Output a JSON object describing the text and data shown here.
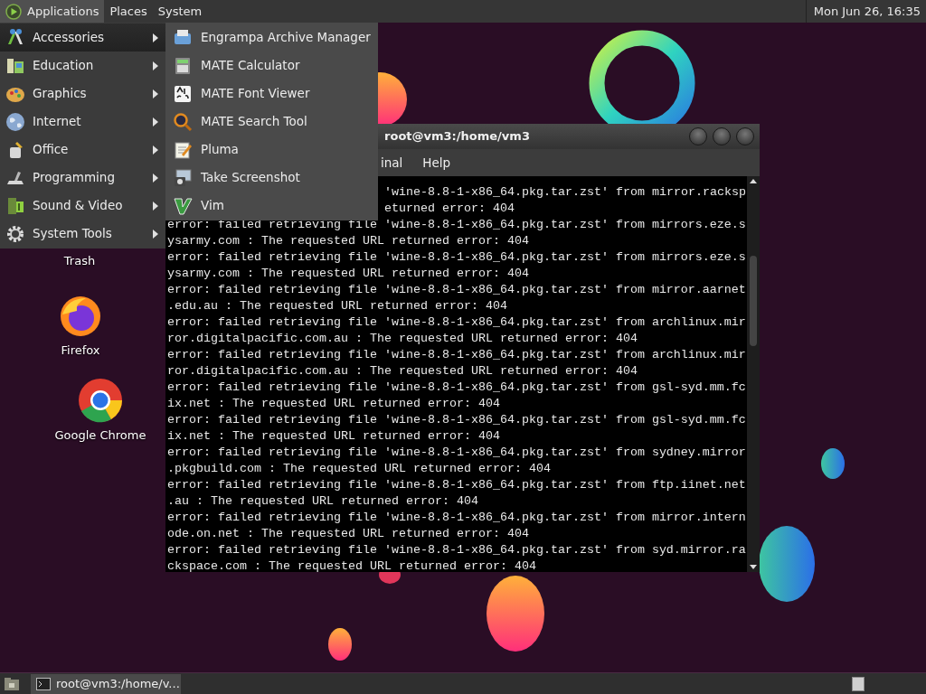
{
  "top_panel": {
    "menus": [
      {
        "label": "Applications",
        "selected": true
      },
      {
        "label": "Places",
        "selected": false
      },
      {
        "label": "System",
        "selected": false
      }
    ],
    "clock": "Mon Jun 26, 16:35"
  },
  "applications_menu": {
    "categories": [
      {
        "label": "Accessories",
        "selected": true
      },
      {
        "label": "Education",
        "selected": false
      },
      {
        "label": "Graphics",
        "selected": false
      },
      {
        "label": "Internet",
        "selected": false
      },
      {
        "label": "Office",
        "selected": false
      },
      {
        "label": "Programming",
        "selected": false
      },
      {
        "label": "Sound & Video",
        "selected": false
      },
      {
        "label": "System Tools",
        "selected": false
      }
    ],
    "submenu": [
      "Engrampa Archive Manager",
      "MATE Calculator",
      "MATE Font Viewer",
      "MATE Search Tool",
      "Pluma",
      "Take Screenshot",
      "Vim"
    ]
  },
  "desktop_icons": [
    {
      "label": "Trash",
      "kind": "trash"
    },
    {
      "label": "Firefox",
      "kind": "firefox"
    },
    {
      "label": "Google Chrome",
      "kind": "chrome"
    }
  ],
  "terminal": {
    "title": "root@vm3:/home/vm3",
    "menu": [
      "inal",
      "Help"
    ],
    "lines": [
      {
        "text": "'wine-8.8-1-x86_64.pkg.tar.zst' from mirror.racksp",
        "kind": "partial"
      },
      {
        "text": "eturned error: 404",
        "kind": "partial"
      },
      {
        "text": "error: failed retrieving file 'wine-8.8-1-x86_64.pkg.tar.zst' from mirrors.eze.s",
        "kind": "full"
      },
      {
        "text": "ysarmy.com : The requested URL returned error: 404",
        "kind": "full"
      },
      {
        "text": "error: failed retrieving file 'wine-8.8-1-x86_64.pkg.tar.zst' from mirrors.eze.s",
        "kind": "full"
      },
      {
        "text": "ysarmy.com : The requested URL returned error: 404",
        "kind": "full"
      },
      {
        "text": "error: failed retrieving file 'wine-8.8-1-x86_64.pkg.tar.zst' from mirror.aarnet",
        "kind": "full"
      },
      {
        "text": ".edu.au : The requested URL returned error: 404",
        "kind": "full"
      },
      {
        "text": "error: failed retrieving file 'wine-8.8-1-x86_64.pkg.tar.zst' from archlinux.mir",
        "kind": "full"
      },
      {
        "text": "ror.digitalpacific.com.au : The requested URL returned error: 404",
        "kind": "full"
      },
      {
        "text": "error: failed retrieving file 'wine-8.8-1-x86_64.pkg.tar.zst' from archlinux.mir",
        "kind": "full"
      },
      {
        "text": "ror.digitalpacific.com.au : The requested URL returned error: 404",
        "kind": "full"
      },
      {
        "text": "error: failed retrieving file 'wine-8.8-1-x86_64.pkg.tar.zst' from gsl-syd.mm.fc",
        "kind": "full"
      },
      {
        "text": "ix.net : The requested URL returned error: 404",
        "kind": "full"
      },
      {
        "text": "error: failed retrieving file 'wine-8.8-1-x86_64.pkg.tar.zst' from gsl-syd.mm.fc",
        "kind": "full"
      },
      {
        "text": "ix.net : The requested URL returned error: 404",
        "kind": "full"
      },
      {
        "text": "error: failed retrieving file 'wine-8.8-1-x86_64.pkg.tar.zst' from sydney.mirror",
        "kind": "full"
      },
      {
        "text": ".pkgbuild.com : The requested URL returned error: 404",
        "kind": "full"
      },
      {
        "text": "error: failed retrieving file 'wine-8.8-1-x86_64.pkg.tar.zst' from ftp.iinet.net",
        "kind": "full"
      },
      {
        "text": ".au : The requested URL returned error: 404",
        "kind": "full"
      },
      {
        "text": "error: failed retrieving file 'wine-8.8-1-x86_64.pkg.tar.zst' from mirror.intern",
        "kind": "full"
      },
      {
        "text": "ode.on.net : The requested URL returned error: 404",
        "kind": "full"
      },
      {
        "text": "error: failed retrieving file 'wine-8.8-1-x86_64.pkg.tar.zst' from syd.mirror.ra",
        "kind": "full"
      },
      {
        "text": "ckspace.com : The requested URL returned error: 404",
        "kind": "full"
      }
    ]
  },
  "taskbar": {
    "tasks": [
      {
        "label": "root@vm3:/home/v..."
      }
    ]
  }
}
